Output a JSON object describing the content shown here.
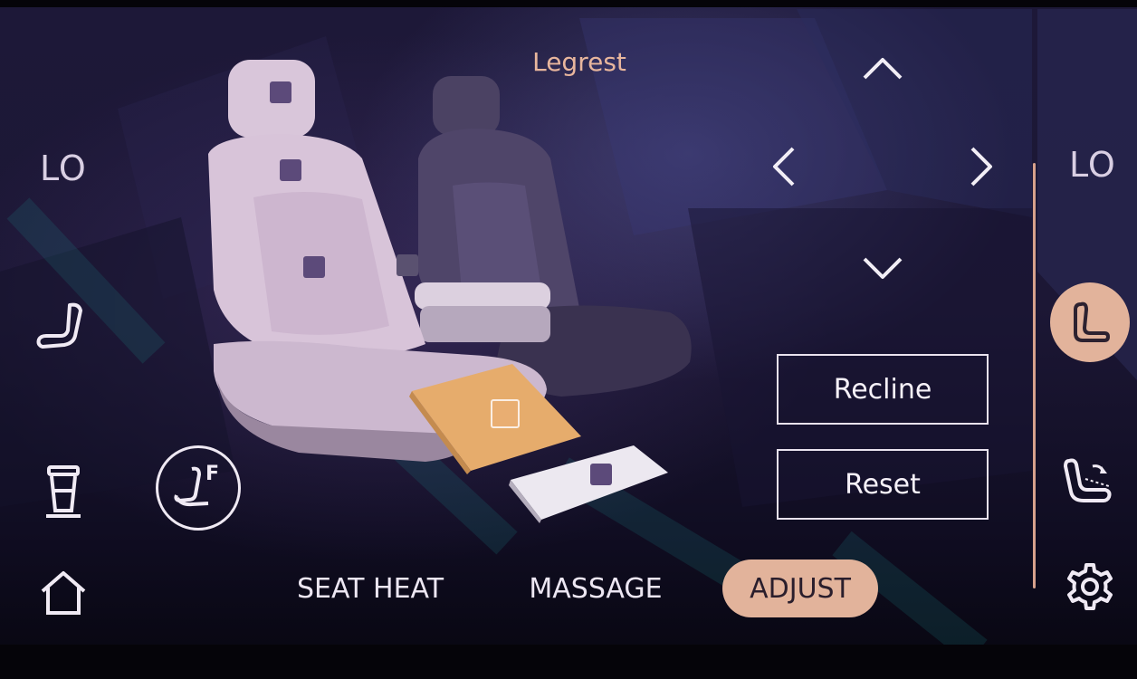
{
  "header": {
    "title": "Legrest"
  },
  "left_panel": {
    "temp_level": "LO",
    "icons": [
      "seat-icon",
      "cup-holder-icon",
      "front-seat-icon",
      "home-icon"
    ],
    "front_seat_badge": "F"
  },
  "right_panel": {
    "temp_level": "LO",
    "icons": [
      "seat-icon",
      "recline-seat-icon",
      "gear-icon"
    ]
  },
  "controls": {
    "arrows": [
      "up",
      "left",
      "right",
      "down"
    ],
    "recline_label": "Recline",
    "reset_label": "Reset"
  },
  "tabs": [
    {
      "label": "SEAT HEAT",
      "active": false
    },
    {
      "label": "MASSAGE",
      "active": false
    },
    {
      "label": "ADJUST",
      "active": true
    }
  ],
  "colors": {
    "accent": "#e2b39b",
    "title": "#e8b69d",
    "legrest_highlight": "#e9ae72",
    "seat_front": "#d6c3d6",
    "seat_rear": "#4e4468"
  }
}
